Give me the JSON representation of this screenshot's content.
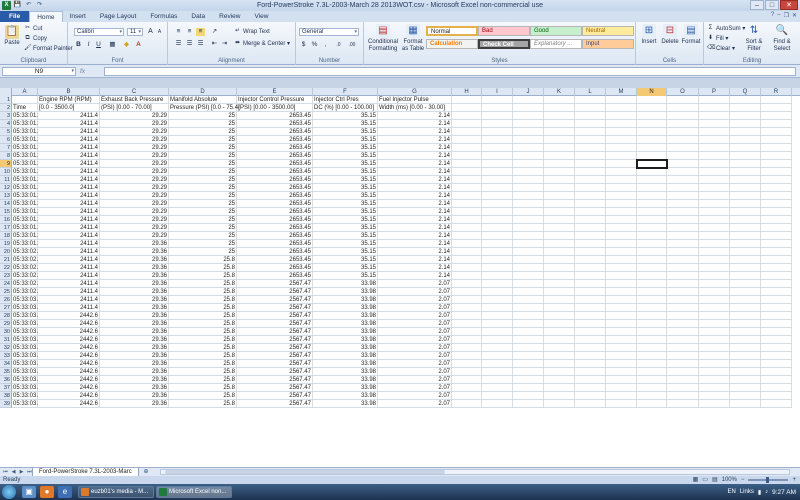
{
  "window": {
    "title": "Ford-PowerStroke 7.3L-2003-March 28 2013WOT.csv - Microsoft Excel non-commercial use",
    "minimize": "–",
    "maximize": "□",
    "close": "✕"
  },
  "qat": {
    "save": "💾",
    "undo": "↶",
    "redo": "↷"
  },
  "ribbon_tabs": [
    "File",
    "Home",
    "Insert",
    "Page Layout",
    "Formulas",
    "Data",
    "Review",
    "View"
  ],
  "ribbon_tab_active": "Home",
  "ribbon": {
    "clipboard": {
      "paste": "Paste",
      "cut": "Cut",
      "copy": "Copy",
      "format_painter": "Format Painter",
      "label": "Clipboard"
    },
    "font": {
      "name": "Calibri",
      "size": "11",
      "grow": "A",
      "shrink": "A",
      "bold": "B",
      "italic": "I",
      "underline": "U",
      "label": "Font"
    },
    "alignment": {
      "wrap_text": "Wrap Text",
      "merge_center": "Merge & Center",
      "label": "Alignment"
    },
    "number": {
      "format": "General",
      "currency": "$",
      "percent": "%",
      "comma": ",",
      "inc_dec": ".0",
      "dec_dec": ".00",
      "label": "Number"
    },
    "styles": {
      "conditional": "Conditional Formatting",
      "format_table": "Format as Table",
      "normal": "Normal",
      "bad": "Bad",
      "good": "Good",
      "neutral": "Neutral",
      "calculation": "Calculation",
      "check_cell": "Check Cell",
      "explanatory": "Explanatory ...",
      "input": "Input",
      "label": "Styles"
    },
    "cells": {
      "insert": "Insert",
      "delete": "Delete",
      "format": "Format",
      "label": "Cells"
    },
    "editing": {
      "autosum": "AutoSum",
      "fill": "Fill",
      "clear": "Clear",
      "sort_filter": "Sort & Filter",
      "find_select": "Find & Select",
      "label": "Editing"
    }
  },
  "formula_bar": {
    "name_box": "N9",
    "fx": "fx",
    "value": ""
  },
  "columns": [
    "A",
    "B",
    "C",
    "D",
    "E",
    "F",
    "G",
    "H",
    "I",
    "J",
    "K",
    "L",
    "M",
    "N",
    "O",
    "P",
    "Q",
    "R"
  ],
  "selected_col": "N",
  "selected_row": 9,
  "header_rows": [
    [
      "",
      "Engine RPM (RPM)",
      "Exhaust Back Pressure",
      "Manifold Absolute",
      "Injector Control Pressure",
      "Injector Ctrl Pres",
      "Fuel Injector Pulse"
    ],
    [
      "Time",
      "[0.0 - 3500.0]",
      "(PSI) [0.00 - 70.00]",
      "Pressure (PSI) [0.0 - 75.4]",
      "(PSI) [0.00 - 3500.00]",
      "DC (%) [0.00 - 100.00]",
      "Width (ms) [0.00 - 30.00]"
    ]
  ],
  "data_rows": [
    [
      "05:33:01.",
      "2411.4",
      "29.29",
      "25",
      "2653.45",
      "35.15",
      "2.14"
    ],
    [
      "05:33:01.",
      "2411.4",
      "29.29",
      "25",
      "2653.45",
      "35.15",
      "2.14"
    ],
    [
      "05:33:01.",
      "2411.4",
      "29.29",
      "25",
      "2653.45",
      "35.15",
      "2.14"
    ],
    [
      "05:33:01.",
      "2411.4",
      "29.29",
      "25",
      "2653.45",
      "35.15",
      "2.14"
    ],
    [
      "05:33:01.",
      "2411.4",
      "29.29",
      "25",
      "2653.45",
      "35.15",
      "2.14"
    ],
    [
      "05:33:01.",
      "2411.4",
      "29.29",
      "25",
      "2653.45",
      "35.15",
      "2.14"
    ],
    [
      "05:33:01.",
      "2411.4",
      "29.29",
      "25",
      "2653.45",
      "35.15",
      "2.14"
    ],
    [
      "05:33:01.",
      "2411.4",
      "29.29",
      "25",
      "2653.45",
      "35.15",
      "2.14"
    ],
    [
      "05:33:01.",
      "2411.4",
      "29.29",
      "25",
      "2653.45",
      "35.15",
      "2.14"
    ],
    [
      "05:33:01.",
      "2411.4",
      "29.29",
      "25",
      "2653.45",
      "35.15",
      "2.14"
    ],
    [
      "05:33:01.",
      "2411.4",
      "29.29",
      "25",
      "2653.45",
      "35.15",
      "2.14"
    ],
    [
      "05:33:01.",
      "2411.4",
      "29.29",
      "25",
      "2653.45",
      "35.15",
      "2.14"
    ],
    [
      "05:33:01.",
      "2411.4",
      "29.29",
      "25",
      "2653.45",
      "35.15",
      "2.14"
    ],
    [
      "05:33:01.",
      "2411.4",
      "29.29",
      "25",
      "2653.45",
      "35.15",
      "2.14"
    ],
    [
      "05:33:01.",
      "2411.4",
      "29.29",
      "25",
      "2653.45",
      "35.15",
      "2.14"
    ],
    [
      "05:33:01.",
      "2411.4",
      "29.29",
      "25",
      "2653.45",
      "35.15",
      "2.14"
    ],
    [
      "05:33:01.",
      "2411.4",
      "29.36",
      "25",
      "2653.45",
      "35.15",
      "2.14"
    ],
    [
      "05:33:02.",
      "2411.4",
      "29.36",
      "25",
      "2653.45",
      "35.15",
      "2.14"
    ],
    [
      "05:33:02.",
      "2411.4",
      "29.36",
      "25.8",
      "2653.45",
      "35.15",
      "2.14"
    ],
    [
      "05:33:02.",
      "2411.4",
      "29.36",
      "25.8",
      "2653.45",
      "35.15",
      "2.14"
    ],
    [
      "05:33:02.",
      "2411.4",
      "29.36",
      "25.8",
      "2653.45",
      "35.15",
      "2.14"
    ],
    [
      "05:33:02.",
      "2411.4",
      "29.36",
      "25.8",
      "2567.47",
      "33.98",
      "2.07"
    ],
    [
      "05:33:02.",
      "2411.4",
      "29.36",
      "25.8",
      "2567.47",
      "33.98",
      "2.07"
    ],
    [
      "05:33:03.",
      "2411.4",
      "29.36",
      "25.8",
      "2567.47",
      "33.98",
      "2.07"
    ],
    [
      "05:33:03.",
      "2411.4",
      "29.36",
      "25.8",
      "2567.47",
      "33.98",
      "2.07"
    ],
    [
      "05:33:03.",
      "2442.6",
      "29.36",
      "25.8",
      "2567.47",
      "33.98",
      "2.07"
    ],
    [
      "05:33:03.",
      "2442.6",
      "29.36",
      "25.8",
      "2567.47",
      "33.98",
      "2.07"
    ],
    [
      "05:33:03.",
      "2442.6",
      "29.36",
      "25.8",
      "2567.47",
      "33.98",
      "2.07"
    ],
    [
      "05:33:03.",
      "2442.6",
      "29.36",
      "25.8",
      "2567.47",
      "33.98",
      "2.07"
    ],
    [
      "05:33:03.",
      "2442.6",
      "29.36",
      "25.8",
      "2567.47",
      "33.98",
      "2.07"
    ],
    [
      "05:33:03.",
      "2442.6",
      "29.36",
      "25.8",
      "2567.47",
      "33.98",
      "2.07"
    ],
    [
      "05:33:03.",
      "2442.6",
      "29.36",
      "25.8",
      "2567.47",
      "33.98",
      "2.07"
    ],
    [
      "05:33:03.",
      "2442.6",
      "29.36",
      "25.8",
      "2567.47",
      "33.98",
      "2.07"
    ],
    [
      "05:33:03.",
      "2442.6",
      "29.36",
      "25.8",
      "2567.47",
      "33.98",
      "2.07"
    ],
    [
      "05:33:03.",
      "2442.6",
      "29.36",
      "25.8",
      "2567.47",
      "33.98",
      "2.07"
    ],
    [
      "05:33:03.",
      "2442.6",
      "29.36",
      "25.8",
      "2567.47",
      "33.98",
      "2.07"
    ],
    [
      "05:33:03.",
      "2442.6",
      "29.36",
      "25.8",
      "2567.47",
      "33.98",
      "2.07"
    ]
  ],
  "sheet_tab": "Ford-PowerStroke 7.3L-2003-Marc",
  "status": {
    "ready": "Ready",
    "zoom": "100%"
  },
  "taskbar": {
    "items": [
      "euzb01's media - M...",
      "Microsoft Excel non..."
    ],
    "lang": "EN",
    "links": "Links",
    "time": "9:27 AM"
  }
}
